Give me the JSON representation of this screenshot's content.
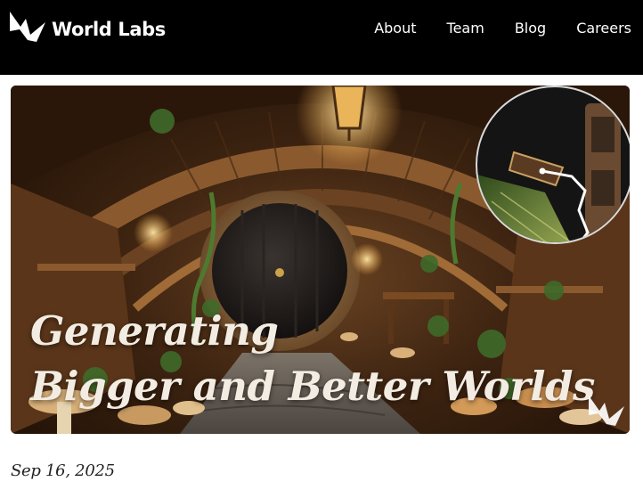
{
  "site": {
    "name": "World Labs",
    "logo_icon": "world-labs-logo-icon"
  },
  "nav": {
    "items": [
      {
        "label": "About"
      },
      {
        "label": "Team"
      },
      {
        "label": "Blog"
      },
      {
        "label": "Careers"
      }
    ]
  },
  "hero": {
    "title_line1": "Generating",
    "title_line2": "Bigger and Better Worlds",
    "image_subject": "hobbit-hole-interior-scene",
    "inset_subject": "aerial-path-map-inset",
    "corner_icon": "world-labs-logo-icon"
  },
  "post": {
    "date": "Sep 16, 2025"
  },
  "colors": {
    "header_bg": "#000000",
    "page_bg": "#ffffff",
    "hero_text": "#f3ece2",
    "date_text": "#222222"
  }
}
